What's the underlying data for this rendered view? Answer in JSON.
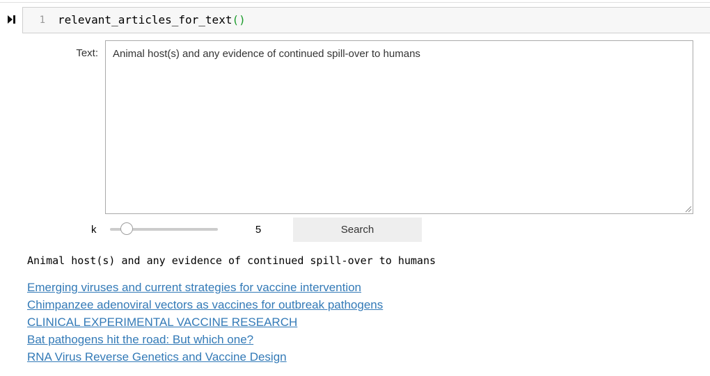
{
  "code_cell": {
    "line_number": "1",
    "code_name": "relevant_articles_for_text",
    "code_parens": "()"
  },
  "widget": {
    "text_label": "Text:",
    "text_value": "Animal host(s) and any evidence of continued spill-over to humans",
    "k_label": "k",
    "k_value": "5",
    "k_slider": {
      "min": 1,
      "max": 30,
      "value": 5
    },
    "search_label": "Search"
  },
  "output": {
    "query": "Animal host(s) and any evidence of continued spill-over to humans",
    "results": [
      "Emerging viruses and current strategies for vaccine intervention",
      "Chimpanzee adenoviral vectors as vaccines for outbreak pathogens",
      "CLINICAL EXPERIMENTAL VACCINE RESEARCH",
      "Bat pathogens hit the road: But which one?",
      "RNA Virus Reverse Genetics and Vaccine Design"
    ]
  },
  "colors": {
    "link": "#337ab7",
    "code_paren": "#1a9b2a",
    "cell_background": "#f7f7f7"
  }
}
